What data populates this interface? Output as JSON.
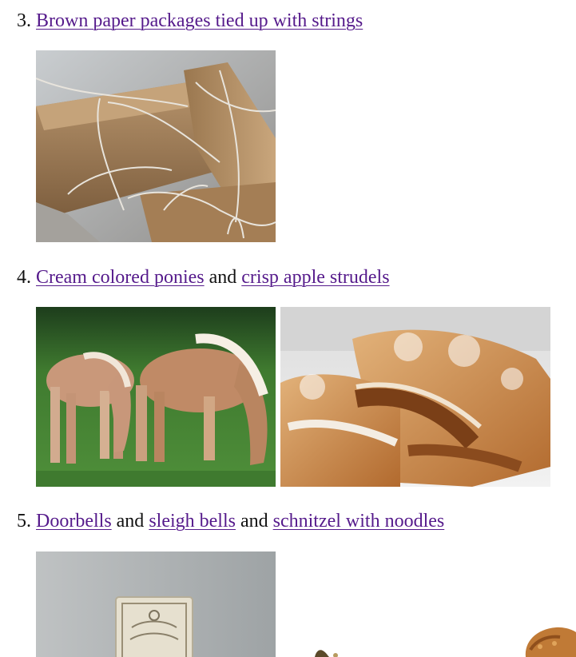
{
  "items": [
    {
      "number": "3.",
      "links": [
        "Brown paper packages tied up with strings"
      ]
    },
    {
      "number": "4.",
      "links": [
        "Cream colored ponies",
        "crisp apple strudels"
      ],
      "joiners": [
        "and"
      ]
    },
    {
      "number": "5.",
      "links": [
        "Doorbells",
        "sleigh bells",
        "schnitzel with noodles"
      ],
      "joiners": [
        "and",
        "and"
      ]
    }
  ]
}
